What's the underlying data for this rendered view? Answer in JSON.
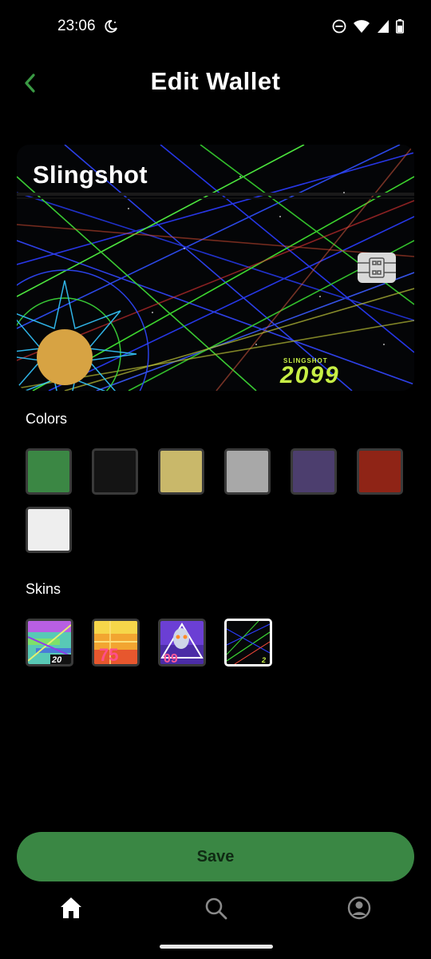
{
  "status_bar": {
    "time": "23:06",
    "icons": [
      "moon-icon",
      "do-not-disturb-icon",
      "wifi-icon",
      "signal-icon",
      "battery-icon"
    ]
  },
  "header": {
    "title": "Edit Wallet",
    "back_icon": "chevron-left-icon",
    "accent_color": "#3a9a44"
  },
  "card": {
    "name": "Slingshot",
    "brand_small": "SLINGSHOT",
    "brand_big": "2099",
    "coin_color": "#d7a343",
    "brand_color": "#c7ef45"
  },
  "colors_section": {
    "label": "Colors",
    "swatches": [
      "#3b8744",
      "#141414",
      "#c9b86a",
      "#a8a8a8",
      "#4c3e6e",
      "#8f2416",
      "#eeeeee"
    ]
  },
  "skins_section": {
    "label": "Skins",
    "skins": [
      {
        "name": "glitch-skin",
        "text": "20"
      },
      {
        "name": "retro-skin",
        "text": "75"
      },
      {
        "name": "face-skin",
        "text": "09"
      },
      {
        "name": "slingshot-skin",
        "text": "2",
        "selected": true
      }
    ]
  },
  "save_button": {
    "label": "Save",
    "color": "#3a8744"
  },
  "bottom_nav": {
    "items": [
      "home-icon",
      "search-icon",
      "profile-icon"
    ]
  }
}
